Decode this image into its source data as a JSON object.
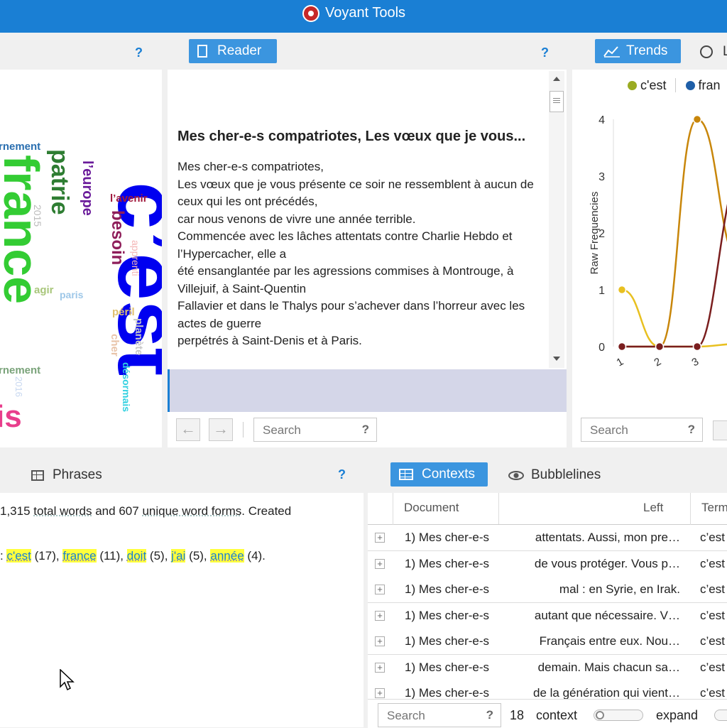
{
  "app": {
    "title": "Voyant Tools"
  },
  "cirrus": {
    "help": "?"
  },
  "reader": {
    "tab_label": "Reader",
    "help": "?",
    "doc_title": "Mes cher-e-s compatriotes, Les vœux que je vous...",
    "lines": [
      "Mes cher-e-s compatriotes,",
      "Les vœux que je vous présente ce soir ne ressemblent à aucun de ceux qui les ont précédés,",
      "car nous venons de vivre une année terrible.",
      "Commencée avec les lâches attentats contre Charlie Hebdo et l’Hypercacher, elle a",
      "été ensanglantée par les agressions commises à Montrouge, à Villejuif, à Saint-Quentin",
      "Fallavier et dans le Thalys pour s’achever dans l’horreur avec les actes de guerre",
      "perpétrés à Saint-Denis et à Paris."
    ],
    "search_placeholder": "Search",
    "search_help": "?"
  },
  "trends": {
    "tab_label": "Trends",
    "next_tab_label": "L",
    "legend": [
      "c'est",
      "fran"
    ],
    "search_placeholder": "Search",
    "search_help": "?"
  },
  "chart_data": {
    "type": "line",
    "ylabel": "Raw Frequencies",
    "x": [
      "1",
      "2",
      "3"
    ],
    "ylim": [
      0,
      4
    ],
    "yticks": [
      "0",
      "1",
      "2",
      "3",
      "4"
    ],
    "series": [
      {
        "name": "c'est",
        "color": "#c8860a",
        "values": [
          0,
          0,
          4
        ]
      },
      {
        "name": "",
        "color": "#e8c020",
        "values": [
          1,
          0,
          0
        ]
      },
      {
        "name": "",
        "color": "#7a1e1e",
        "values": [
          0,
          0,
          0
        ]
      }
    ]
  },
  "summary": {
    "tab_label": "Phrases",
    "help": "?",
    "line1_pre": "1,315",
    "line1_a": "total words",
    "line1_b": "and",
    "line1_c": "607",
    "line1_d": "unique word forms",
    "line1_e": ". Created",
    "line2_prefix": ":",
    "terms": [
      {
        "word": "c'est",
        "count": "(17),"
      },
      {
        "word": "france",
        "count": "(11),"
      },
      {
        "word": "doit",
        "count": "(5),"
      },
      {
        "word": "j'ai",
        "count": "(5),"
      },
      {
        "word": "année",
        "count": "(4)."
      }
    ]
  },
  "contexts": {
    "tab_label": "Contexts",
    "bubble_label": "Bubblelines",
    "columns": {
      "document": "Document",
      "left": "Left",
      "term": "Term"
    },
    "rows": [
      {
        "doc": "1) Mes cher-e-s",
        "left": "attentats. Aussi, mon pre…",
        "term": "c’est"
      },
      {
        "doc": "1) Mes cher-e-s",
        "left": "de vous protéger. Vous p…",
        "term": "c’est"
      },
      {
        "doc": "1) Mes cher-e-s",
        "left": "mal : en Syrie, en Irak.",
        "term": "c’est"
      },
      {
        "doc": "1) Mes cher-e-s",
        "left": "autant que nécessaire. V…",
        "term": "c’est"
      },
      {
        "doc": "1) Mes cher-e-s",
        "left": "Français entre eux. Nou…",
        "term": "c’est"
      },
      {
        "doc": "1) Mes cher-e-s",
        "left": "demain. Mais chacun sa…",
        "term": "c’est"
      },
      {
        "doc": "1) Mes cher-e-s",
        "left": "de la génération qui vient…",
        "term": "c’est"
      }
    ],
    "search_placeholder": "Search",
    "search_help": "?",
    "context_count": "18",
    "context_label": "context",
    "expand_label": "expand"
  }
}
